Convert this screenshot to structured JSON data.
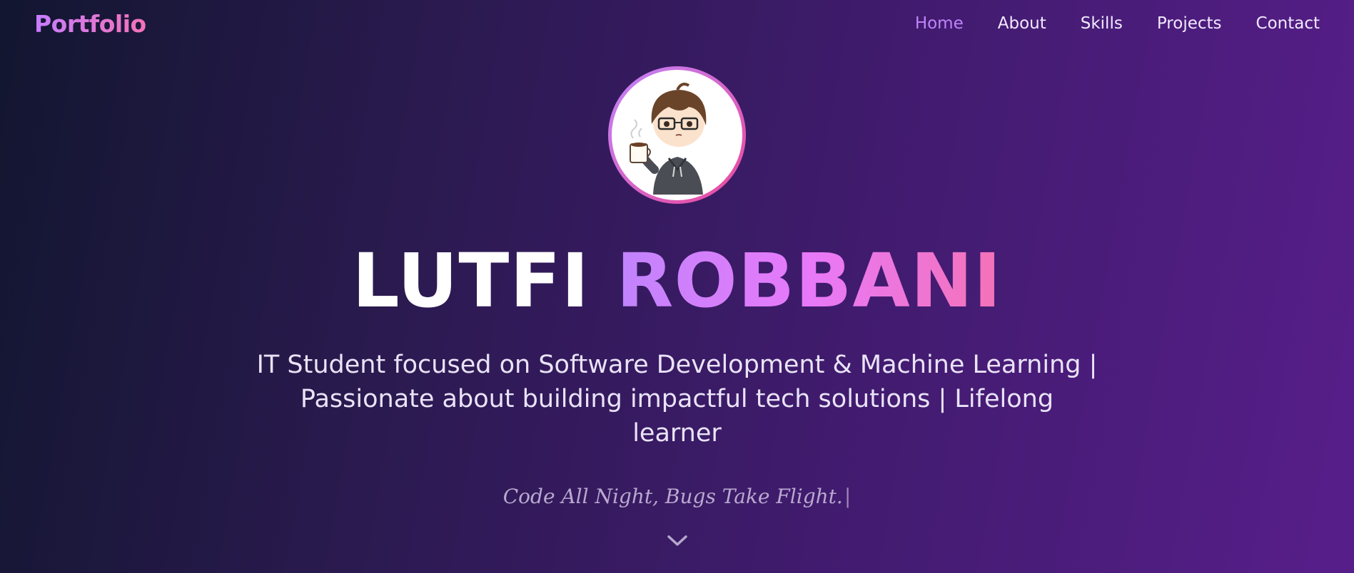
{
  "nav": {
    "logo": "Portfolio",
    "links": [
      {
        "label": "Home",
        "active": true
      },
      {
        "label": "About",
        "active": false
      },
      {
        "label": "Skills",
        "active": false
      },
      {
        "label": "Projects",
        "active": false
      },
      {
        "label": "Contact",
        "active": false
      }
    ]
  },
  "hero": {
    "avatar_icon": "chibi-avatar-with-coffee",
    "first_name": "LUTFI",
    "last_name": "ROBBANI",
    "tagline_line1": "IT Student focused on Software Development & Machine Learning |",
    "tagline_line2": "Passionate about building impactful tech solutions | Lifelong learner",
    "motto": "Code All Night, Bugs Take Flight.",
    "cursor": "|",
    "scroll_icon": "chevron-down-icon"
  },
  "colors": {
    "accent_purple": "#c084fc",
    "accent_pink": "#f472b6",
    "background_start": "#121630",
    "background_end": "#571e8a"
  }
}
